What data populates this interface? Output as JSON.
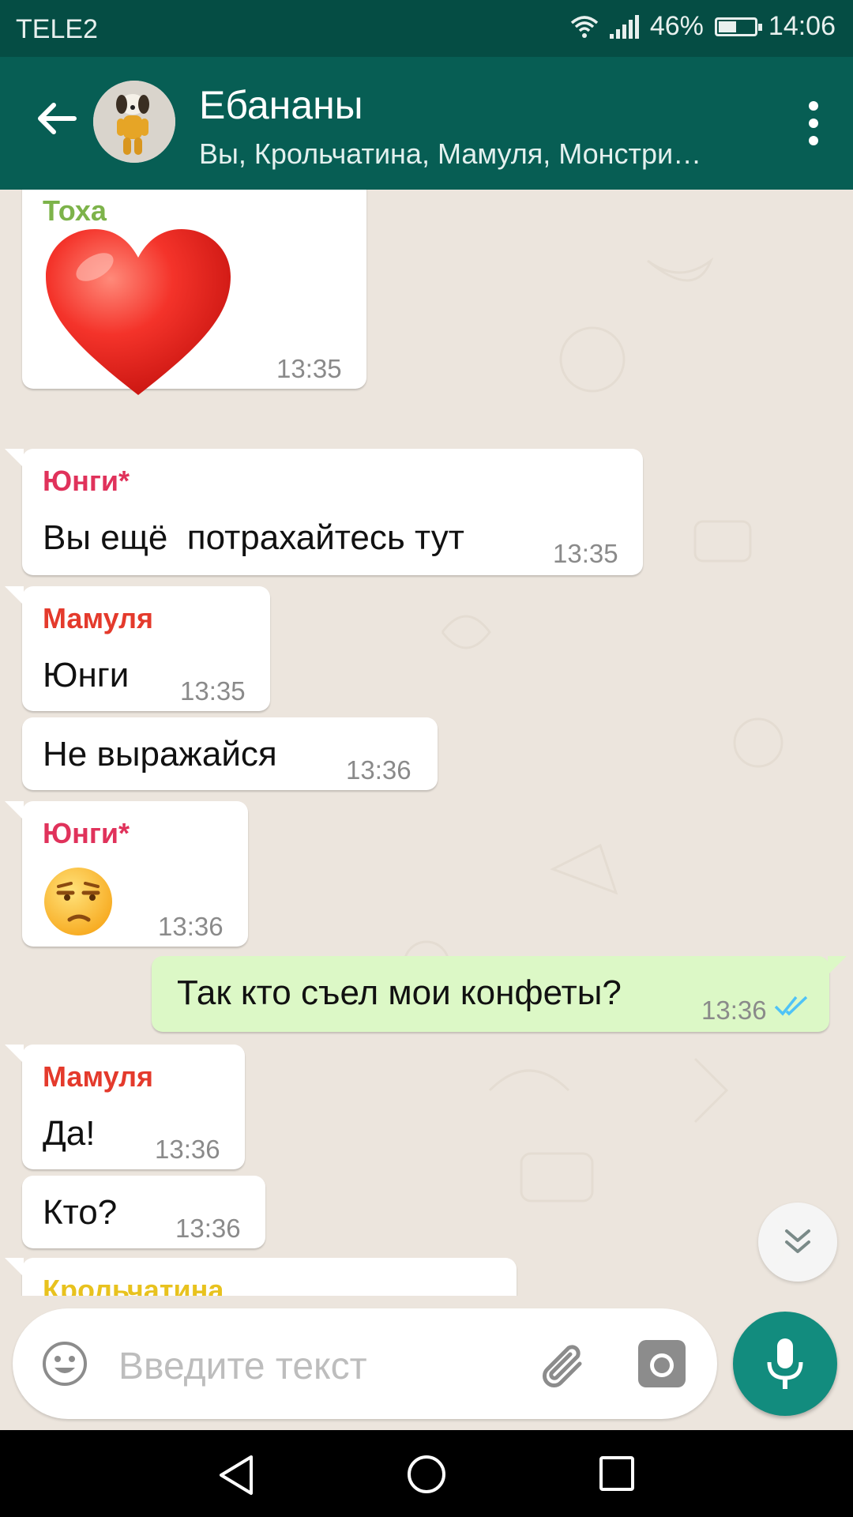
{
  "status_bar": {
    "carrier": "TELE2",
    "battery": "46%",
    "time": "14:06"
  },
  "header": {
    "title": "Ебананы",
    "subtitle": "Вы, Крольчатина, Мамуля, Монстри…"
  },
  "colors": {
    "header_bg": "#075E54",
    "status_bar_bg": "#054D44",
    "chat_bg": "#ECE5DD",
    "outgoing_bubble": "#DCF8C6",
    "accent": "#128C7E",
    "sender_toxa": "#7DB34A",
    "sender_yungi": "#E0325B",
    "sender_mamulya": "#E43A2C",
    "sender_krolchatina": "#E8C21E",
    "read_ticks": "#4FC3F7"
  },
  "messages": [
    {
      "sender": "Тоха",
      "content_icon": "heart-emoji",
      "time": "13:35"
    },
    {
      "sender": "Юнги*",
      "text": "Вы ещё  потрахайтесь тут",
      "time": "13:35"
    },
    {
      "sender": "Мамуля",
      "text": "Юнги",
      "time": "13:35"
    },
    {
      "text": "Не выражайся",
      "time": "13:36"
    },
    {
      "sender": "Юнги*",
      "content_icon": "unamused-face-emoji",
      "time": "13:36"
    },
    {
      "outgoing": true,
      "text": "Так кто съел мои конфеты?",
      "time": "13:36",
      "status": "read"
    },
    {
      "sender": "Мамуля",
      "text": "Да!",
      "time": "13:36"
    },
    {
      "text": "Кто?",
      "time": "13:36"
    },
    {
      "sender": "Крольчатина"
    }
  ],
  "composer": {
    "placeholder": "Введите текст"
  }
}
